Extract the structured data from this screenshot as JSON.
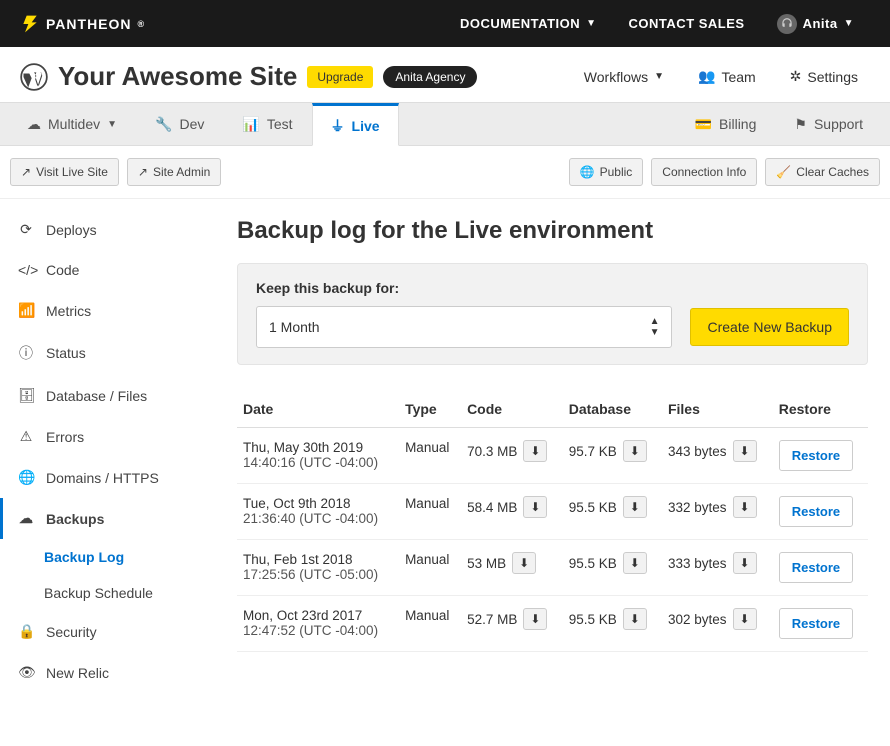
{
  "topbar": {
    "brand": "PANTHEON",
    "docs": "DOCUMENTATION",
    "contact": "CONTACT SALES",
    "user": "Anita"
  },
  "site": {
    "title": "Your Awesome Site",
    "upgrade": "Upgrade",
    "agency": "Anita Agency"
  },
  "header_links": {
    "workflows": "Workflows",
    "team": "Team",
    "settings": "Settings"
  },
  "env_tabs": {
    "multidev": "Multidev",
    "dev": "Dev",
    "test": "Test",
    "live": "Live",
    "billing": "Billing",
    "support": "Support"
  },
  "actions": {
    "visit": "Visit Live Site",
    "admin": "Site Admin",
    "public": "Public",
    "conn": "Connection Info",
    "clear": "Clear Caches"
  },
  "sidebar": {
    "deploys": "Deploys",
    "code": "Code",
    "metrics": "Metrics",
    "status": "Status",
    "db": "Database / Files",
    "errors": "Errors",
    "domains": "Domains / HTTPS",
    "backups": "Backups",
    "backup_log": "Backup Log",
    "backup_sched": "Backup Schedule",
    "security": "Security",
    "newrelic": "New Relic"
  },
  "page": {
    "title": "Backup log for the Live environment",
    "keep_label": "Keep this backup for:",
    "keep_value": "1 Month",
    "create_btn": "Create New Backup"
  },
  "table": {
    "headers": {
      "date": "Date",
      "type": "Type",
      "code": "Code",
      "db": "Database",
      "files": "Files",
      "restore": "Restore"
    },
    "restore_label": "Restore",
    "rows": [
      {
        "date1": "Thu, May 30th 2019",
        "date2": "14:40:16 (UTC -04:00)",
        "type": "Manual",
        "code": "70.3 MB",
        "db": "95.7 KB",
        "files": "343 bytes"
      },
      {
        "date1": "Tue, Oct 9th 2018",
        "date2": "21:36:40 (UTC -04:00)",
        "type": "Manual",
        "code": "58.4 MB",
        "db": "95.5 KB",
        "files": "332 bytes"
      },
      {
        "date1": "Thu, Feb 1st 2018",
        "date2": "17:25:56 (UTC -05:00)",
        "type": "Manual",
        "code": "53 MB",
        "db": "95.5 KB",
        "files": "333 bytes"
      },
      {
        "date1": "Mon, Oct 23rd 2017",
        "date2": "12:47:52 (UTC -04:00)",
        "type": "Manual",
        "code": "52.7 MB",
        "db": "95.5 KB",
        "files": "302 bytes"
      }
    ]
  }
}
